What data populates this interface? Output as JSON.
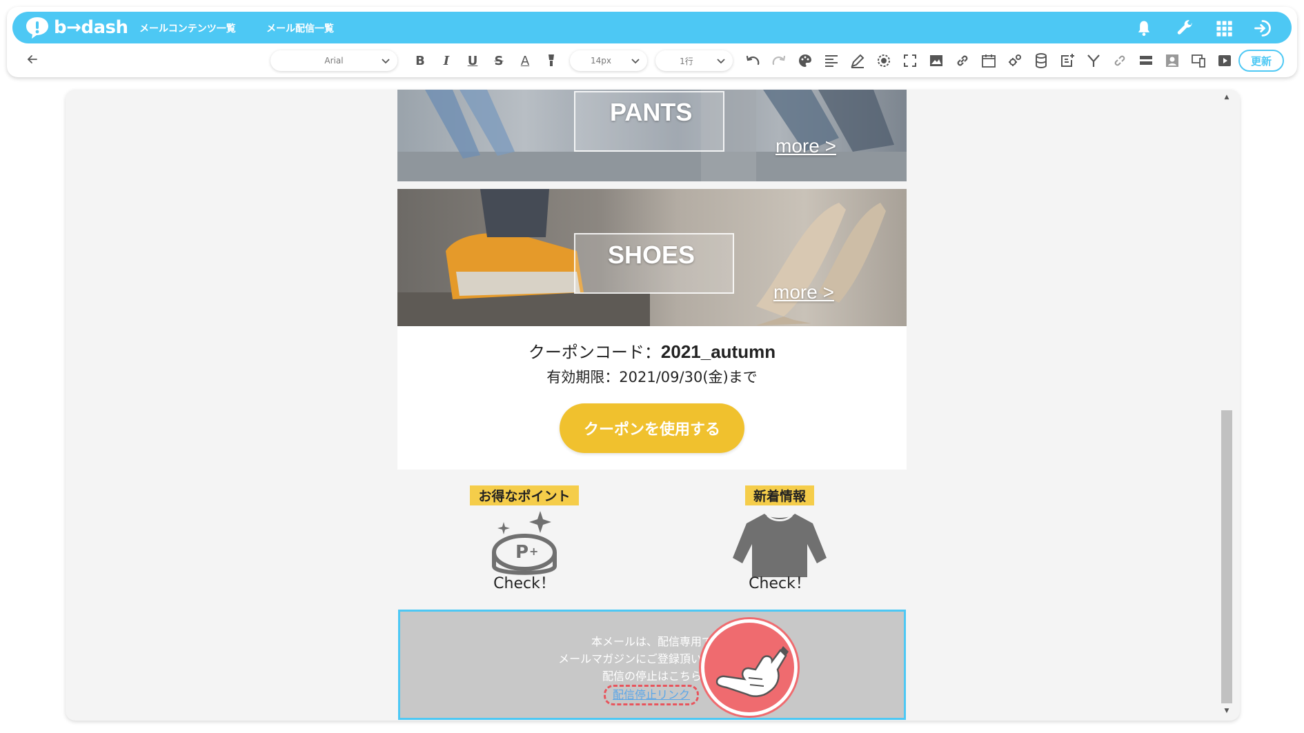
{
  "app": {
    "logo_text": "b→dash",
    "nav": [
      "メールコンテンツ一覧",
      "メール配信一覧"
    ]
  },
  "toolbar": {
    "font_family": "Arial",
    "font_size": "14px",
    "line_height": "1行",
    "update_label": "更新"
  },
  "email": {
    "banners": [
      {
        "label": "PANTS",
        "more": "more >"
      },
      {
        "label": "SHOES",
        "more": "more >"
      }
    ],
    "coupon": {
      "code_label": "クーポンコード：",
      "code_value": "2021_autumn",
      "expiry": "有効期限：2021/09/30(金)まで",
      "button": "クーポンを使用する"
    },
    "features": [
      {
        "tag": "お得なポイント",
        "check": "Check！"
      },
      {
        "tag": "新着情報",
        "check": "Check！"
      }
    ],
    "footer": {
      "line1": "本メールは、配信専用で",
      "line2": "メールマガジンにご登録頂いた方にお",
      "line3": "配信の停止はこちら",
      "unsubscribe_link": "配信停止リンク"
    }
  },
  "colors": {
    "brand": "#4dc8f4",
    "coupon_button": "#f0c12e",
    "tag": "#f5cd4a",
    "highlight": "#ef6b6f"
  }
}
